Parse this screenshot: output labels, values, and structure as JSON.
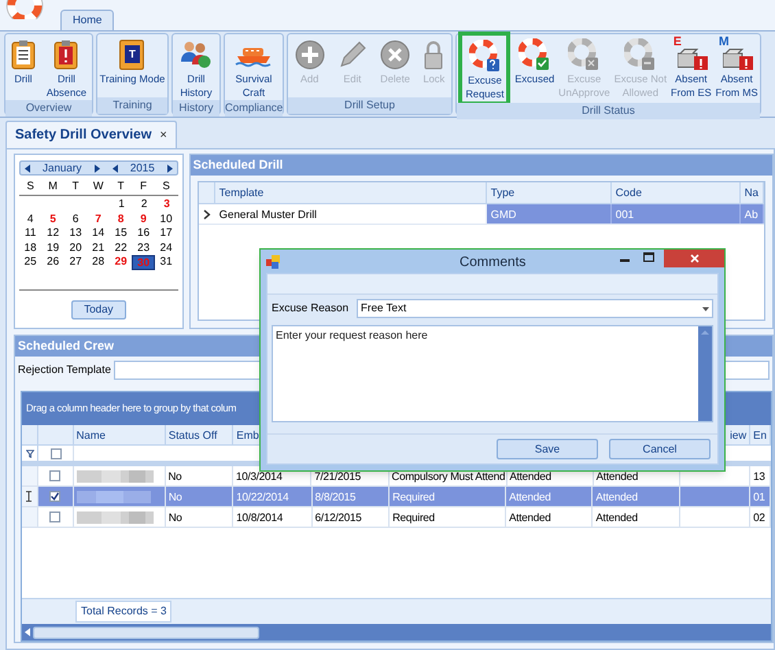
{
  "app_tab": {
    "label": "Home",
    "selected": true
  },
  "ribbon": {
    "groups": [
      {
        "label": "Overview",
        "buttons": [
          {
            "kind": "clipboard",
            "lines": [
              "Drill"
            ],
            "disabled": false,
            "highlighted": false
          },
          {
            "kind": "clipboard-alert",
            "lines": [
              "Drill",
              "Absence"
            ],
            "disabled": false,
            "highlighted": false
          }
        ]
      },
      {
        "label": "Training",
        "buttons": [
          {
            "kind": "clipboard-letter",
            "badge": "T",
            "lines": [
              "Training Mode"
            ],
            "disabled": false,
            "highlighted": false
          }
        ]
      },
      {
        "label": "History",
        "buttons": [
          {
            "kind": "people",
            "lines": [
              "Drill",
              "History"
            ],
            "disabled": false,
            "highlighted": false
          }
        ]
      },
      {
        "label": "Compliance",
        "buttons": [
          {
            "kind": "boat",
            "lines": [
              "Survival",
              "Craft"
            ],
            "disabled": false,
            "highlighted": false
          }
        ]
      },
      {
        "label": "Drill Setup",
        "buttons": [
          {
            "kind": "plus",
            "lines": [
              "Add"
            ],
            "disabled": true,
            "highlighted": false
          },
          {
            "kind": "pencil",
            "lines": [
              "Edit"
            ],
            "disabled": true,
            "highlighted": false
          },
          {
            "kind": "x-circle",
            "lines": [
              "Delete"
            ],
            "disabled": true,
            "highlighted": false
          },
          {
            "kind": "lock",
            "lines": [
              "Lock"
            ],
            "disabled": true,
            "highlighted": false
          }
        ]
      },
      {
        "label": "Drill Status",
        "buttons": [
          {
            "kind": "buoy-question",
            "lines": [
              "Excuse",
              "Request"
            ],
            "disabled": false,
            "highlighted": true
          },
          {
            "kind": "buoy-check",
            "lines": [
              "Excused"
            ],
            "disabled": false,
            "highlighted": false
          },
          {
            "kind": "buoy-x",
            "lines": [
              "Excuse",
              "UnApprove"
            ],
            "disabled": true,
            "highlighted": false
          },
          {
            "kind": "buoy-minus",
            "lines": [
              "Excuse Not",
              "Allowed"
            ],
            "disabled": true,
            "highlighted": false
          },
          {
            "kind": "absent",
            "badge": "E",
            "lines": [
              "Absent",
              "From ES"
            ],
            "disabled": false,
            "highlighted": false
          },
          {
            "kind": "absent",
            "badge": "M",
            "lines": [
              "Absent",
              "From MS"
            ],
            "disabled": false,
            "highlighted": false
          }
        ]
      }
    ]
  },
  "doc_tab": {
    "label": "Safety Drill Overview",
    "close": "×",
    "selected": true
  },
  "calendar": {
    "month": "January",
    "year": "2015",
    "weekdays": [
      "S",
      "M",
      "T",
      "W",
      "T",
      "F",
      "S"
    ],
    "weeks": [
      [
        {
          "day": "1",
          "marked": false,
          "selected": false
        },
        {
          "day": "2",
          "marked": false,
          "selected": false
        },
        {
          "day": "3",
          "marked": true,
          "selected": false
        }
      ],
      [
        {
          "day": "4",
          "marked": false,
          "selected": false
        },
        {
          "day": "5",
          "marked": true,
          "selected": false
        },
        {
          "day": "6",
          "marked": false,
          "selected": false
        },
        {
          "day": "7",
          "marked": true,
          "selected": false
        },
        {
          "day": "8",
          "marked": true,
          "selected": false
        },
        {
          "day": "9",
          "marked": true,
          "selected": false
        },
        {
          "day": "10",
          "marked": false,
          "selected": false
        }
      ],
      [
        {
          "day": "11",
          "marked": false,
          "selected": false
        },
        {
          "day": "12",
          "marked": false,
          "selected": false
        },
        {
          "day": "13",
          "marked": false,
          "selected": false
        },
        {
          "day": "14",
          "marked": false,
          "selected": false
        },
        {
          "day": "15",
          "marked": false,
          "selected": false
        },
        {
          "day": "16",
          "marked": false,
          "selected": false
        },
        {
          "day": "17",
          "marked": false,
          "selected": false
        }
      ],
      [
        {
          "day": "18",
          "marked": false,
          "selected": false
        },
        {
          "day": "19",
          "marked": false,
          "selected": false
        },
        {
          "day": "20",
          "marked": false,
          "selected": false
        },
        {
          "day": "21",
          "marked": false,
          "selected": false
        },
        {
          "day": "22",
          "marked": false,
          "selected": false
        },
        {
          "day": "23",
          "marked": false,
          "selected": false
        },
        {
          "day": "24",
          "marked": false,
          "selected": false
        }
      ],
      [
        {
          "day": "25",
          "marked": false,
          "selected": false
        },
        {
          "day": "26",
          "marked": false,
          "selected": false
        },
        {
          "day": "27",
          "marked": false,
          "selected": false
        },
        {
          "day": "28",
          "marked": false,
          "selected": false
        },
        {
          "day": "29",
          "marked": true,
          "selected": false
        },
        {
          "day": "30",
          "marked": true,
          "selected": true
        },
        {
          "day": "31",
          "marked": false,
          "selected": false
        }
      ]
    ],
    "today_button": "Today"
  },
  "scheduled_drill": {
    "title": "Scheduled Drill",
    "columns": [
      "Template",
      "Type",
      "Code",
      "Na"
    ],
    "rows": [
      {
        "selected": true,
        "cells": [
          "General Muster Drill",
          "GMD",
          "001",
          "Ab"
        ]
      }
    ]
  },
  "scheduled_crew": {
    "title": "Scheduled Crew",
    "rejection_label": "Rejection Template",
    "group_hint": "Drag a column header here to group by that colum",
    "select_all_checked": false,
    "header_left": [
      "Name",
      "Status Off",
      "Emb"
    ],
    "header_right": [
      "iew",
      "En"
    ],
    "rows": [
      {
        "selected": false,
        "checked": false,
        "cells": [
          "No",
          "10/3/2014",
          "7/21/2015",
          "Compulsory Must Attend",
          "Attended",
          "Attended",
          "13"
        ]
      },
      {
        "selected": true,
        "checked": true,
        "cells": [
          "No",
          "10/22/2014",
          "8/8/2015",
          "Required",
          "Attended",
          "Attended",
          "01"
        ]
      },
      {
        "selected": false,
        "checked": false,
        "cells": [
          "No",
          "10/8/2014",
          "6/12/2015",
          "Required",
          "Attended",
          "Attended",
          "02"
        ]
      }
    ],
    "total": "Total Records = 3"
  },
  "dialog": {
    "title": "Comments",
    "reason_label": "Excuse Reason",
    "reason_value": "Free Text",
    "placeholder": "Enter your request reason here",
    "buttons": [
      "Save",
      "Cancel"
    ]
  }
}
